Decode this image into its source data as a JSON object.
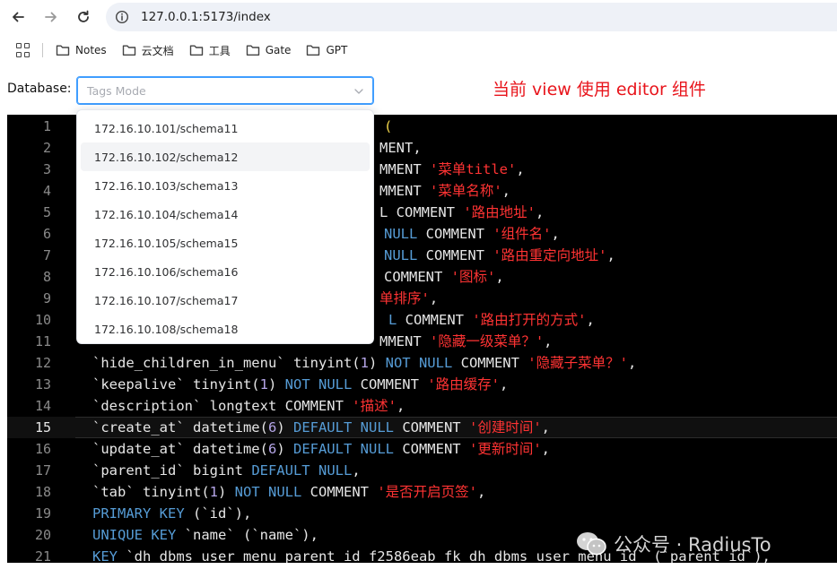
{
  "browser": {
    "url": "127.0.0.1:5173/index",
    "bookmarks": [
      {
        "label": "Notes"
      },
      {
        "label": "云文档"
      },
      {
        "label": "工具"
      },
      {
        "label": "Gate"
      },
      {
        "label": "GPT"
      }
    ]
  },
  "form": {
    "database_label": "Database:",
    "select_placeholder": "Tags Mode"
  },
  "annotation": "当前 view 使用 editor 组件",
  "dropdown": {
    "options": [
      "172.16.10.101/schema11",
      "172.16.10.102/schema12",
      "172.16.10.103/schema13",
      "172.16.10.104/schema14",
      "172.16.10.105/schema15",
      "172.16.10.106/schema16",
      "172.16.10.107/schema17",
      "172.16.10.108/schema18"
    ],
    "hovered_index": 1
  },
  "editor": {
    "active_line": 15,
    "lines": [
      {
        "n": "1",
        "tokens": [
          [
            "t-paren",
            "("
          ]
        ],
        "visible_from": 420
      },
      {
        "n": "2",
        "tokens": [
          [
            "t-plain",
            "MENT,"
          ]
        ],
        "visible_from": 415
      },
      {
        "n": "3",
        "tokens": [
          [
            "t-plain",
            "MMENT "
          ],
          [
            "t-str",
            "'菜单title'"
          ],
          [
            "t-plain",
            ","
          ]
        ],
        "visible_from": 415
      },
      {
        "n": "4",
        "tokens": [
          [
            "t-plain",
            "MMENT "
          ],
          [
            "t-str",
            "'菜单名称'"
          ],
          [
            "t-plain",
            ","
          ]
        ],
        "visible_from": 415
      },
      {
        "n": "5",
        "tokens": [
          [
            "t-plain",
            "L COMMENT "
          ],
          [
            "t-str",
            "'路由地址'"
          ],
          [
            "t-plain",
            ","
          ]
        ],
        "visible_from": 415
      },
      {
        "n": "6",
        "tokens": [
          [
            "t-null",
            "NULL"
          ],
          [
            "t-plain",
            " COMMENT "
          ],
          [
            "t-str",
            "'组件名'"
          ],
          [
            "t-plain",
            ","
          ]
        ],
        "visible_from": 420
      },
      {
        "n": "7",
        "tokens": [
          [
            "t-null",
            "NULL"
          ],
          [
            "t-plain",
            " COMMENT "
          ],
          [
            "t-str",
            "'路由重定向地址'"
          ],
          [
            "t-plain",
            ","
          ]
        ],
        "visible_from": 420
      },
      {
        "n": "8",
        "tokens": [
          [
            "t-plain",
            "COMMENT "
          ],
          [
            "t-str",
            "'图标'"
          ],
          [
            "t-plain",
            ","
          ]
        ],
        "visible_from": 420
      },
      {
        "n": "9",
        "tokens": [
          [
            "t-str",
            "单排序'"
          ],
          [
            "t-plain",
            ","
          ]
        ],
        "visible_from": 415
      },
      {
        "n": "10",
        "tokens": [
          [
            "t-null",
            "L"
          ],
          [
            "t-plain",
            " COMMENT "
          ],
          [
            "t-str",
            "'路由打开的方式'"
          ],
          [
            "t-plain",
            ","
          ]
        ],
        "visible_from": 425
      },
      {
        "n": "11",
        "tokens": [
          [
            "t-plain",
            "MMENT "
          ],
          [
            "t-str",
            "'隐藏一级菜单？'"
          ],
          [
            "t-plain",
            ","
          ]
        ],
        "visible_from": 415
      },
      {
        "n": "12",
        "tokens": [
          [
            "t-plain",
            "`hide_children_in_menu` tinyint("
          ],
          [
            "t-num",
            "1"
          ],
          [
            "t-plain",
            ") "
          ],
          [
            "t-null",
            "NOT NULL"
          ],
          [
            "t-plain",
            " COMMENT "
          ],
          [
            "t-str",
            "'隐藏子菜单？'"
          ],
          [
            "t-plain",
            ","
          ]
        ],
        "visible_from": 0
      },
      {
        "n": "13",
        "tokens": [
          [
            "t-plain",
            "`keepalive` tinyint("
          ],
          [
            "t-num",
            "1"
          ],
          [
            "t-plain",
            ") "
          ],
          [
            "t-null",
            "NOT NULL"
          ],
          [
            "t-plain",
            " COMMENT "
          ],
          [
            "t-str",
            "'路由缓存'"
          ],
          [
            "t-plain",
            ","
          ]
        ],
        "visible_from": 0
      },
      {
        "n": "14",
        "tokens": [
          [
            "t-plain",
            "`description` longtext COMMENT "
          ],
          [
            "t-str",
            "'描述'"
          ],
          [
            "t-plain",
            ","
          ]
        ],
        "visible_from": 0
      },
      {
        "n": "15",
        "tokens": [
          [
            "t-plain",
            "`create_at` datetime("
          ],
          [
            "t-num",
            "6"
          ],
          [
            "t-plain",
            ") "
          ],
          [
            "t-kw",
            "DEFAULT"
          ],
          [
            "t-plain",
            " "
          ],
          [
            "t-null",
            "NULL"
          ],
          [
            "t-plain",
            " COMMENT "
          ],
          [
            "t-str",
            "'创建时间'"
          ],
          [
            "t-plain",
            ","
          ]
        ],
        "visible_from": 0
      },
      {
        "n": "16",
        "tokens": [
          [
            "t-plain",
            "`update_at` datetime("
          ],
          [
            "t-num",
            "6"
          ],
          [
            "t-plain",
            ") "
          ],
          [
            "t-kw",
            "DEFAULT"
          ],
          [
            "t-plain",
            " "
          ],
          [
            "t-null",
            "NULL"
          ],
          [
            "t-plain",
            " COMMENT "
          ],
          [
            "t-str",
            "'更新时间'"
          ],
          [
            "t-plain",
            ","
          ]
        ],
        "visible_from": 0
      },
      {
        "n": "17",
        "tokens": [
          [
            "t-plain",
            "`parent_id` bigint "
          ],
          [
            "t-kw",
            "DEFAULT"
          ],
          [
            "t-plain",
            " "
          ],
          [
            "t-null",
            "NULL"
          ],
          [
            "t-plain",
            ","
          ]
        ],
        "visible_from": 0
      },
      {
        "n": "18",
        "tokens": [
          [
            "t-plain",
            "`tab` tinyint("
          ],
          [
            "t-num",
            "1"
          ],
          [
            "t-plain",
            ") "
          ],
          [
            "t-null",
            "NOT NULL"
          ],
          [
            "t-plain",
            " COMMENT "
          ],
          [
            "t-str",
            "'是否开启页签'"
          ],
          [
            "t-plain",
            ","
          ]
        ],
        "visible_from": 0
      },
      {
        "n": "19",
        "tokens": [
          [
            "t-kw",
            "PRIMARY KEY"
          ],
          [
            "t-plain",
            " (`id`),"
          ]
        ],
        "visible_from": 0
      },
      {
        "n": "20",
        "tokens": [
          [
            "t-kw",
            "UNIQUE KEY"
          ],
          [
            "t-plain",
            " `name` (`name`),"
          ]
        ],
        "visible_from": 0
      },
      {
        "n": "21",
        "tokens": [
          [
            "t-kw",
            "KEY"
          ],
          [
            "t-plain",
            " `dh_dbms_user_menu_parent_id_f2586eab_fk_dh_dbms_user_menu_id` (`parent_id`),"
          ]
        ],
        "visible_from": 0
      }
    ]
  },
  "watermark": "公众号 · RadiusTo",
  "colors": {
    "accent": "#409eff",
    "annotation": "#e8141b",
    "editor_bg": "#000000",
    "string": "#ff3333",
    "keyword": "#569cd6"
  }
}
